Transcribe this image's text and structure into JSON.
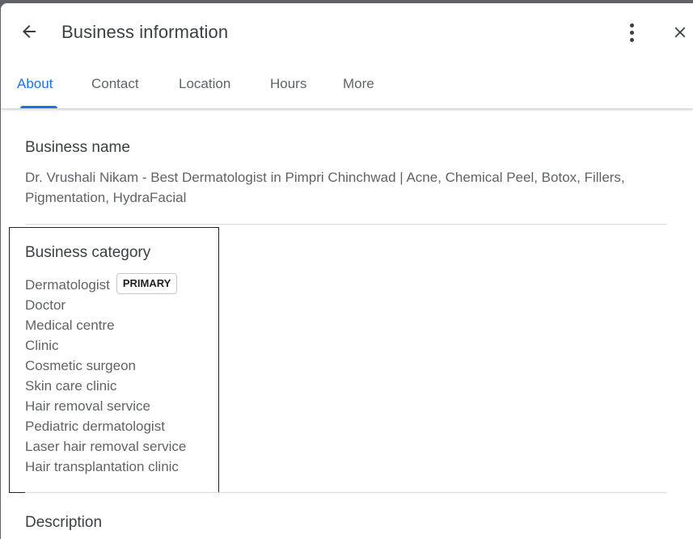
{
  "header": {
    "title": "Business information",
    "back_icon": "arrow-left-icon",
    "more_icon": "more-vertical-icon",
    "close_icon": "close-icon"
  },
  "tabs": [
    {
      "label": "About",
      "active": true
    },
    {
      "label": "Contact",
      "active": false
    },
    {
      "label": "Location",
      "active": false
    },
    {
      "label": "Hours",
      "active": false
    },
    {
      "label": "More",
      "active": false
    }
  ],
  "business_name": {
    "label": "Business name",
    "value": "Dr. Vrushali Nikam - Best Dermatologist in Pimpri Chinchwad | Acne, Chemical Peel, Botox, Fillers, Pigmentation, HydraFacial"
  },
  "business_category": {
    "label": "Business category",
    "primary_badge": "PRIMARY",
    "items": [
      "Dermatologist",
      "Doctor",
      "Medical centre",
      "Clinic",
      "Cosmetic surgeon",
      "Skin care clinic",
      "Hair removal service",
      "Pediatric dermatologist",
      "Laser hair removal service",
      "Hair transplantation clinic"
    ]
  },
  "description": {
    "label": "Description"
  },
  "colors": {
    "accent": "#1a73e8",
    "text_primary": "#3c4043",
    "text_secondary": "#5f6368"
  }
}
